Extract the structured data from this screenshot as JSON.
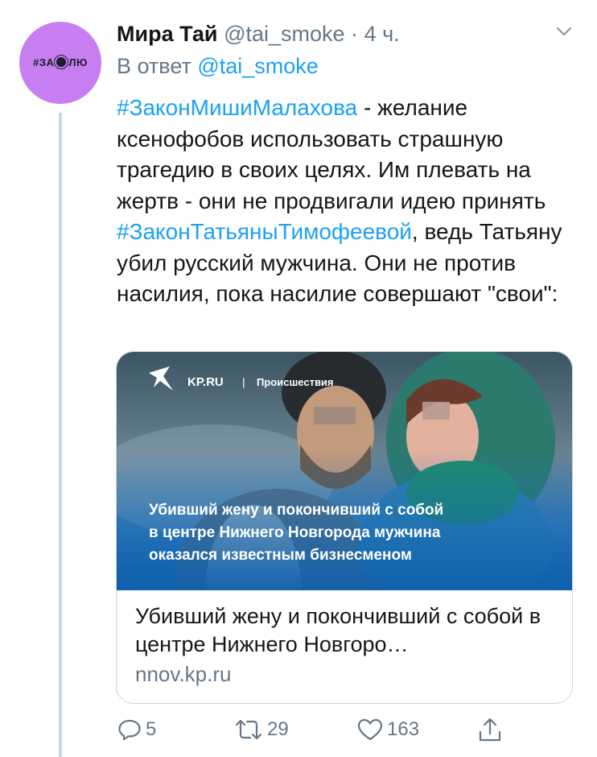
{
  "tweet": {
    "author_name": "Мира Тай",
    "handle": "@tai_smoke",
    "separator": "·",
    "time": "4 ч.",
    "reply_prefix": "В ответ",
    "reply_handle": "@tai_smoke",
    "avatar_text_hash": "#ЗА",
    "avatar_text_end": "ЛЮ",
    "text": {
      "hashtag1": "#ЗаконМишиМалахова",
      "part1": " - желание ксенофобов использовать страшную трагедию в своих целях. Им плевать на жертв - они не продвигали идею принять ",
      "hashtag2": "#ЗаконТатьяныТимофеевой",
      "part2": ", ведь Татьяну убил русский мужчина. Они не против насилия, пока насилие совершают \"свои\":"
    }
  },
  "card": {
    "image_brand": "KP.RU",
    "image_divider": "|",
    "image_section": "Происшествия",
    "image_headline": [
      "Убивший жену и покончивший с собой",
      "в центре Нижнего Новгорода мужчина",
      "оказался известным бизнесменом"
    ],
    "title": "Убивший жену и покончивший с собой в центре Нижнего Новгоро…",
    "domain": "nnov.kp.ru"
  },
  "actions": {
    "replies": "5",
    "retweets": "29",
    "likes": "163"
  },
  "colors": {
    "link": "#1da1f2",
    "secondary": "#657786",
    "avatar_bg": "#c77ef0",
    "thread_line": "#ccd6dd"
  },
  "icons": {
    "reply": "reply-icon",
    "retweet": "retweet-icon",
    "like": "heart-icon",
    "share": "share-icon",
    "menu": "chevron-down-icon"
  }
}
